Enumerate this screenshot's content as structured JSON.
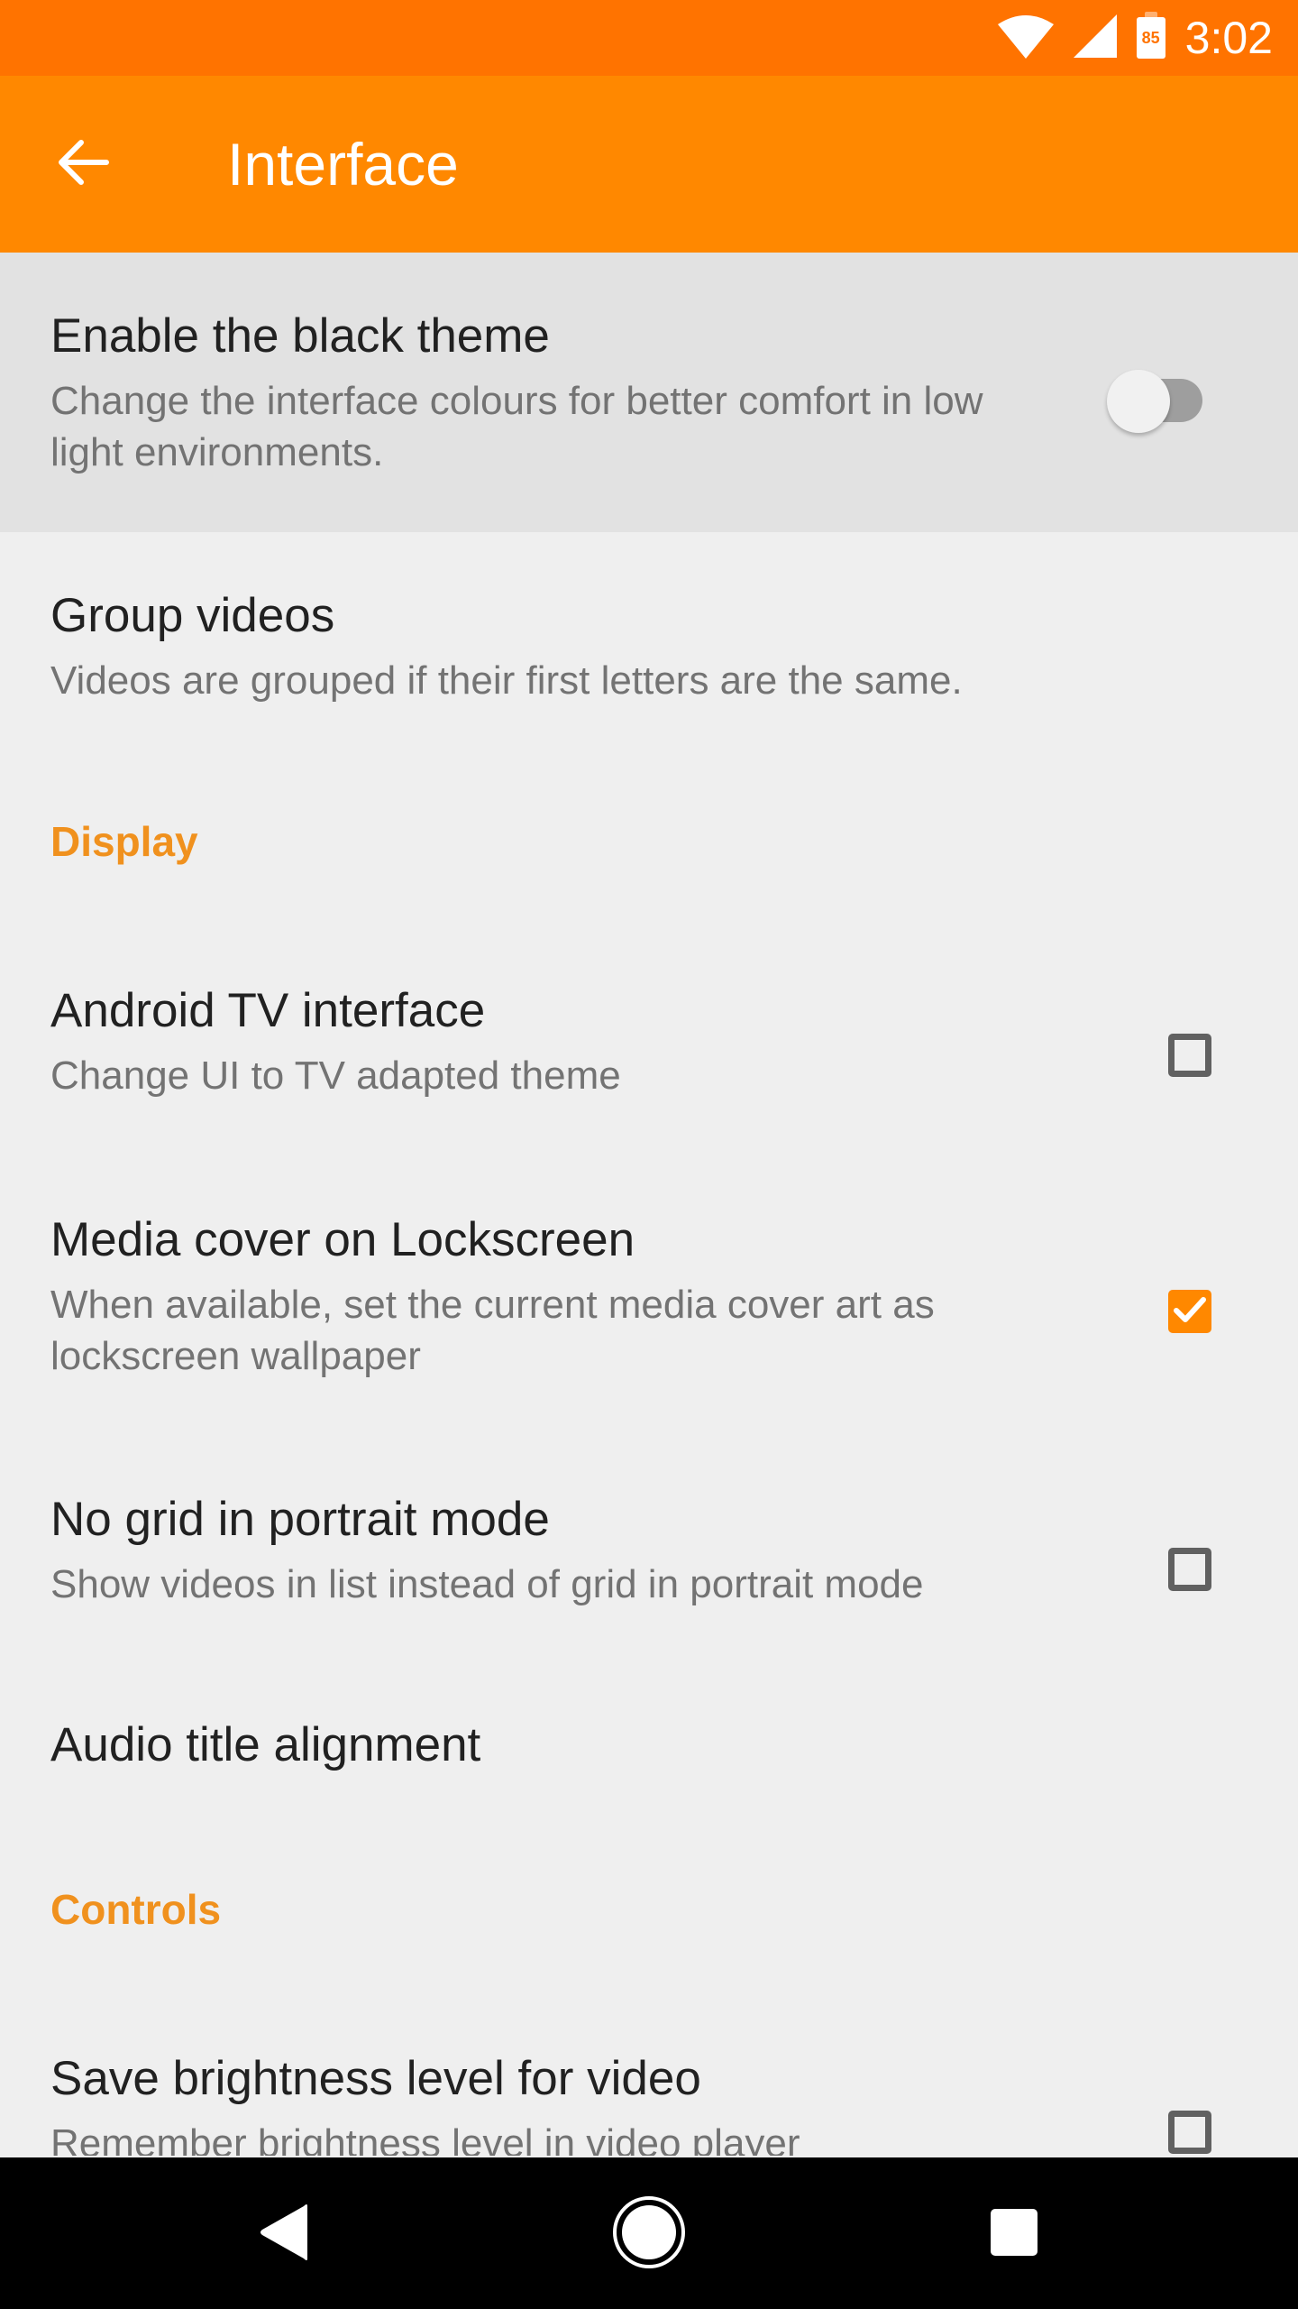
{
  "status_bar": {
    "time": "3:02",
    "battery_level": "85",
    "icons": [
      "wifi-icon",
      "cell-signal-icon",
      "battery-icon"
    ]
  },
  "app_bar": {
    "title": "Interface",
    "back_icon": "arrow-left-icon"
  },
  "preferences": [
    {
      "type": "switch",
      "title": "Enable the black theme",
      "summary": "Change the interface colours for better comfort in low light environments.",
      "checked": false,
      "highlighted": true
    },
    {
      "type": "plain",
      "title": "Group videos",
      "summary": "Videos are grouped if their first letters are the same."
    },
    {
      "type": "category",
      "title": "Display"
    },
    {
      "type": "checkbox",
      "title": "Android TV interface",
      "summary": "Change UI to TV adapted theme",
      "checked": false
    },
    {
      "type": "checkbox",
      "title": "Media cover on Lockscreen",
      "summary": "When available, set the current media cover art as lockscreen wallpaper",
      "checked": true
    },
    {
      "type": "checkbox",
      "title": "No grid in portrait mode",
      "summary": "Show videos in list instead of grid in portrait mode",
      "checked": false
    },
    {
      "type": "plain",
      "title": "Audio title alignment"
    },
    {
      "type": "category",
      "title": "Controls"
    },
    {
      "type": "checkbox",
      "title": "Save brightness level for video",
      "summary": "Remember brightness level in video player",
      "checked": false
    }
  ],
  "nav_bar": {
    "back": "back-triangle-icon",
    "home": "home-circle-icon",
    "recents": "recents-square-icon"
  },
  "colors": {
    "status_bar": "#ff7300",
    "app_bar": "#ff8800",
    "accent": "#f0911e",
    "background": "#efefef"
  }
}
